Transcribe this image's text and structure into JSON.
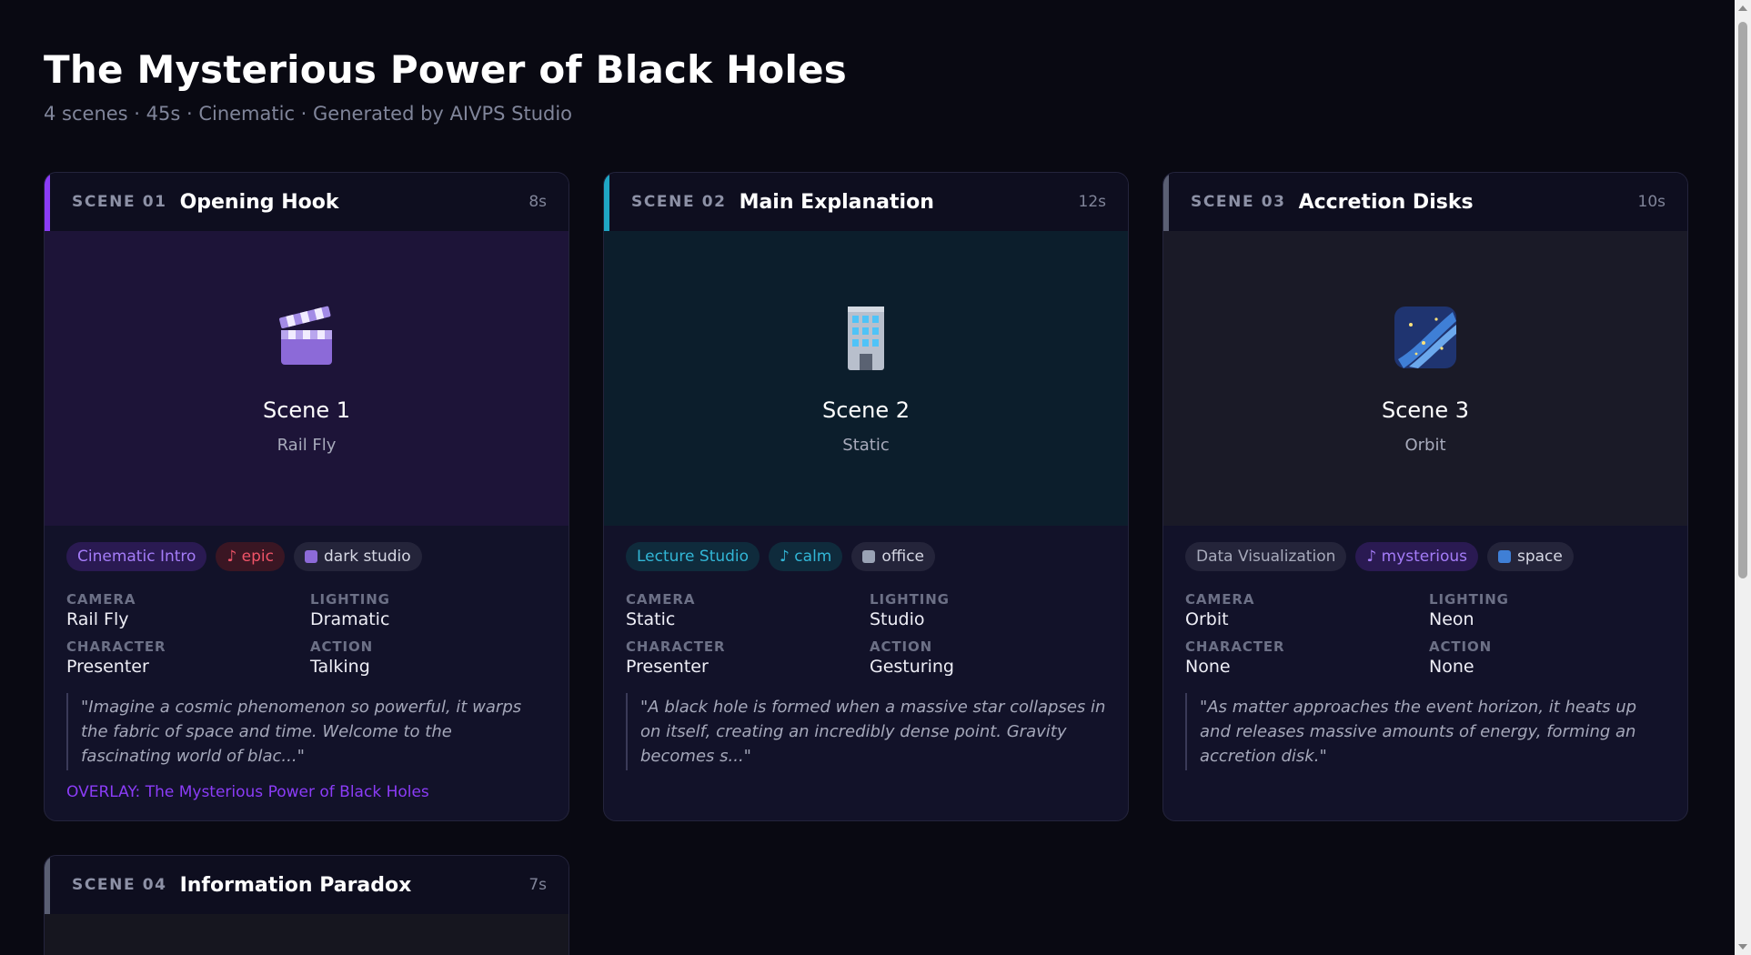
{
  "project": {
    "title": "The Mysterious Power of Black Holes",
    "subtitle": "4 scenes · 45s · Cinematic · Generated by AIVPS Studio"
  },
  "labels": {
    "camera": "CAMERA",
    "lighting": "LIGHTING",
    "character": "CHARACTER",
    "action": "ACTION"
  },
  "colors": {
    "scene_01_accent": "#8b3cf7",
    "scene_02_accent": "#1fa6c4",
    "scene_03_accent": "#5a5f73",
    "scene_04_accent": "#5a5f73",
    "overlay_text": "#8b3cf7"
  },
  "scenes": [
    {
      "number": "SCENE 01",
      "name": "Opening Hook",
      "duration": "8s",
      "icon": "clapperboard-icon",
      "preview_title": "Scene 1",
      "preview_subtitle": "Rail Fly",
      "tags": [
        "Cinematic Intro",
        "♪ epic",
        "dark studio"
      ],
      "camera": "Rail Fly",
      "lighting": "Dramatic",
      "character": "Presenter",
      "action": "Talking",
      "narration": "\"Imagine a cosmic phenomenon so powerful, it warps the fabric of space and time. Welcome to the fascinating world of blac...\"",
      "overlay": "OVERLAY: The Mysterious Power of Black Holes"
    },
    {
      "number": "SCENE 02",
      "name": "Main Explanation",
      "duration": "12s",
      "icon": "office-building-icon",
      "preview_title": "Scene 2",
      "preview_subtitle": "Static",
      "tags": [
        "Lecture Studio",
        "♪ calm",
        "office"
      ],
      "camera": "Static",
      "lighting": "Studio",
      "character": "Presenter",
      "action": "Gesturing",
      "narration": "\"A black hole is formed when a massive star collapses in on itself, creating an incredibly dense point. Gravity becomes s...\""
    },
    {
      "number": "SCENE 03",
      "name": "Accretion Disks",
      "duration": "10s",
      "icon": "milky-way-icon",
      "preview_title": "Scene 3",
      "preview_subtitle": "Orbit",
      "tags": [
        "Data Visualization",
        "♪ mysterious",
        "space"
      ],
      "camera": "Orbit",
      "lighting": "Neon",
      "character": "None",
      "action": "None",
      "narration": "\"As matter approaches the event horizon, it heats up and releases massive amounts of energy, forming an accretion disk.\""
    },
    {
      "number": "SCENE 04",
      "name": "Information Paradox",
      "duration": "7s"
    }
  ]
}
